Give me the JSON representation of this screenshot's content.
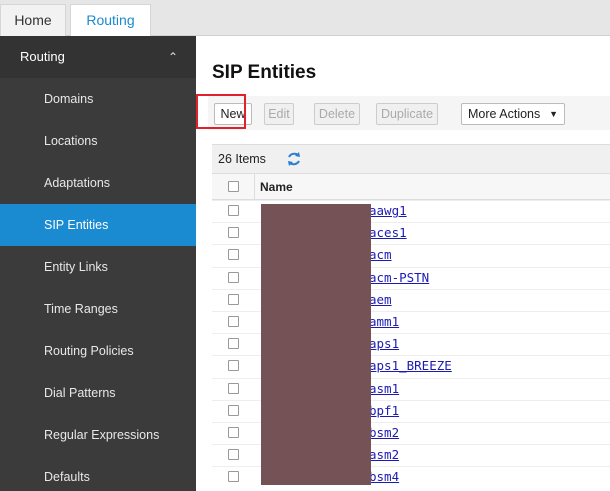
{
  "tabs": {
    "home_label": "Home",
    "routing_label": "Routing"
  },
  "sidebar": {
    "header": "Routing",
    "items": [
      {
        "label": "Domains"
      },
      {
        "label": "Locations"
      },
      {
        "label": "Adaptations"
      },
      {
        "label": "SIP Entities"
      },
      {
        "label": "Entity Links"
      },
      {
        "label": "Time Ranges"
      },
      {
        "label": "Routing Policies"
      },
      {
        "label": "Dial Patterns"
      },
      {
        "label": "Regular Expressions"
      },
      {
        "label": "Defaults"
      }
    ],
    "active_item": "SIP Entities"
  },
  "main": {
    "title": "SIP Entities",
    "toolbar": {
      "new_label": "New",
      "edit_label": "Edit",
      "delete_label": "Delete",
      "duplicate_label": "Duplicate",
      "more_label": "More Actions"
    },
    "count_label": "26 Items",
    "column_name": "Name",
    "rows": [
      "aawg1",
      "aces1",
      "acm",
      "acm-PSTN",
      "aem",
      "amm1",
      "aps1",
      "aps1_BREEZE",
      "asm1",
      "bpf1",
      "bsm2",
      "asm2",
      "bsm4"
    ]
  },
  "colors": {
    "accent": "#1a8ad1",
    "sidebar_bg": "#3b3b3b",
    "highlight": "#e0202a",
    "redaction": "#745256"
  }
}
